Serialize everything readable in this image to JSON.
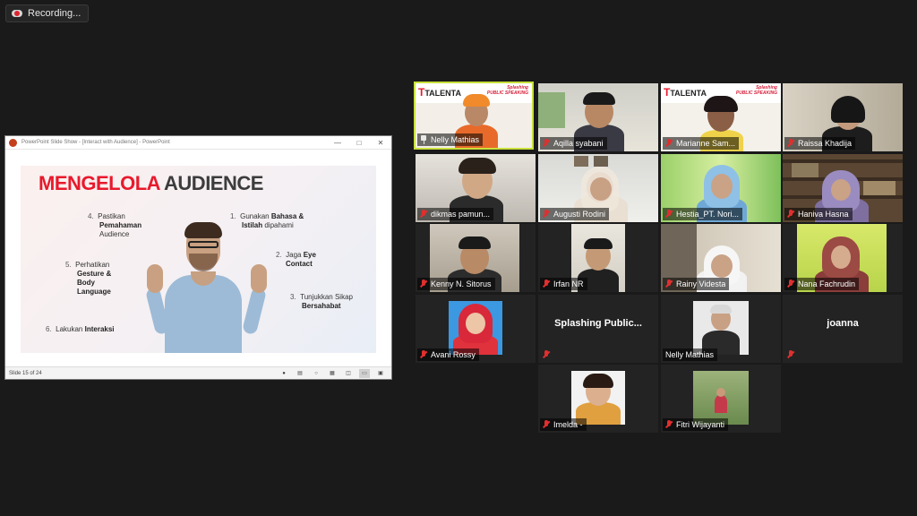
{
  "recording": {
    "label": "Recording..."
  },
  "ppt": {
    "window_title": "PowerPoint Slide Show - [Interact with Audience] - PowerPoint",
    "status": "Slide 15 of 24",
    "slide": {
      "title_red": "MENGELOLA",
      "title_dark": "AUDIENCE",
      "points": [
        {
          "num": "1.",
          "text": "Gunakan",
          "bold": "Bahasa &",
          "line2a": "Istilah",
          "line2b": "dipahami"
        },
        {
          "num": "2.",
          "text": "Jaga",
          "bold": "Eye",
          "line2a": "",
          "line2b": "Contact"
        },
        {
          "num": "3.",
          "text": "Tunjukkan Sikap",
          "bold": "",
          "line2a": "",
          "line2b": "Bersahabat"
        },
        {
          "num": "4.",
          "text": "Pastikan",
          "bold": "",
          "line2a": "Pemahaman",
          "line2b": "Audience"
        },
        {
          "num": "5.",
          "text": "Perhatikan",
          "bold": "",
          "line2a": "Gesture &",
          "line2b": "Body",
          "line3": "Language"
        },
        {
          "num": "6.",
          "text": "Lakukan",
          "bold": "Interaksi",
          "line2a": "",
          "line2b": ""
        }
      ]
    }
  },
  "gallery": {
    "participants": [
      {
        "name": "Nelly Mathias",
        "icon": "pin-icon",
        "speaking": true
      },
      {
        "name": "Aqilla syabani",
        "icon": "mic-muted-icon"
      },
      {
        "name": "Marianne Sam...",
        "icon": "mic-muted-icon"
      },
      {
        "name": "Raissa Khadija",
        "icon": "mic-muted-icon"
      },
      {
        "name": "dikmas pamun...",
        "icon": "mic-muted-icon"
      },
      {
        "name": "Augusti Rodini",
        "icon": "mic-muted-icon"
      },
      {
        "name": "Hestia_PT. Nori...",
        "icon": "mic-muted-icon"
      },
      {
        "name": "Haniva Hasna",
        "icon": "mic-muted-icon"
      },
      {
        "name": "Kenny N. Sitorus",
        "icon": "mic-muted-icon"
      },
      {
        "name": "Irfan NR",
        "icon": "mic-muted-icon"
      },
      {
        "name": "Rainy Videsta",
        "icon": "mic-muted-icon"
      },
      {
        "name": "Nana Fachrudin",
        "icon": "mic-muted-icon"
      },
      {
        "name": "Avani Rossy",
        "icon": "mic-muted-icon"
      },
      {
        "name": "",
        "center_text": "Splashing  Public...",
        "icon": "mic-muted-icon"
      },
      {
        "name": "Nelly Mathias",
        "icon": "none"
      },
      {
        "name": "",
        "center_text": "joanna",
        "icon": "mic-muted-icon"
      },
      {
        "name": "Imelda -",
        "icon": "mic-muted-icon"
      },
      {
        "name": "Fitri Wijayanti",
        "icon": "mic-muted-icon"
      }
    ],
    "banner": {
      "brand": "TALENTA",
      "tagline_1": "Splashing",
      "tagline_2": "PUBLIC SPEAKING"
    }
  }
}
